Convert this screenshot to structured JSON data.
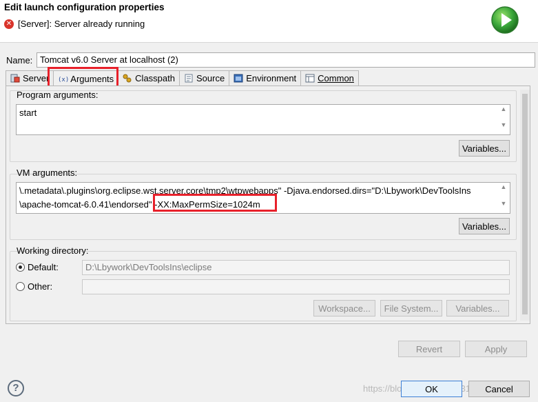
{
  "dialog": {
    "title": "Edit launch configuration properties",
    "message": "[Server]: Server already running",
    "run_icon": "green-run-icon"
  },
  "name": {
    "label": "Name:",
    "value": "Tomcat v6.0 Server at localhost (2)"
  },
  "tabs": [
    {
      "label": "Server",
      "icon": "server-icon",
      "active": false
    },
    {
      "label": "Arguments",
      "icon": "arguments-icon",
      "active": true
    },
    {
      "label": "Classpath",
      "icon": "classpath-icon",
      "active": false
    },
    {
      "label": "Source",
      "icon": "source-icon",
      "active": false
    },
    {
      "label": "Environment",
      "icon": "environment-icon",
      "active": false
    },
    {
      "label": "Common",
      "icon": "common-icon",
      "active": false
    }
  ],
  "program_arguments": {
    "label": "Program arguments:",
    "value": "start",
    "variables_button": "Variables..."
  },
  "vm_arguments": {
    "label": "VM arguments:",
    "line1": "\\.metadata\\.plugins\\org.eclipse.wst.server.core\\tmp2\\wtpwebapps\" -Djava.endorsed.dirs=\"D:\\Lbywork\\DevToolsIns",
    "line2_prefix": "\\apache-tomcat-6.0.41\\endorsed\"",
    "line2_highlight": " -XX:MaxPermSize=1024m",
    "variables_button": "Variables..."
  },
  "working_directory": {
    "label": "Working directory:",
    "default_label": "Default:",
    "default_value": "D:\\Lbywork\\DevToolsIns\\eclipse",
    "other_label": "Other:",
    "other_value": "",
    "workspace_button": "Workspace...",
    "filesystem_button": "File System...",
    "variables_button": "Variables..."
  },
  "buttons": {
    "revert": "Revert",
    "apply": "Apply",
    "ok": "OK",
    "cancel": "Cancel"
  },
  "watermark": "https://blog.csdn.net/qq_31451368",
  "colors": {
    "highlight": "#e8202a",
    "error": "#d9342b",
    "run_green": "#3aa63a"
  }
}
